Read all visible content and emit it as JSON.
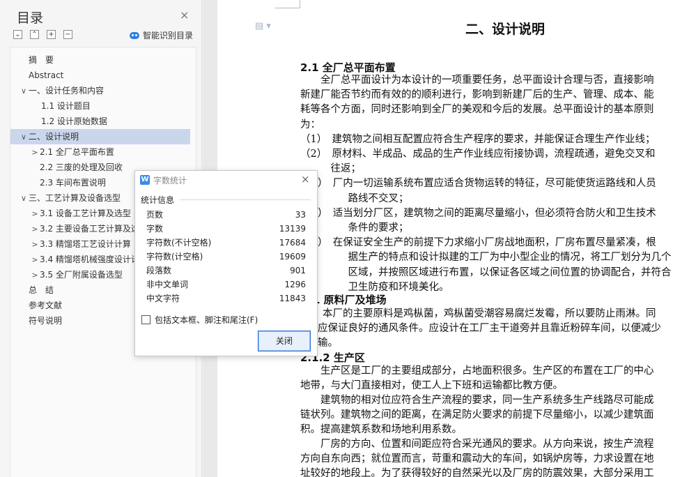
{
  "toc": {
    "title": "目录",
    "close": "×",
    "smart_label": "智能识别目录",
    "items": [
      {
        "label": "摘　要",
        "indent": 0,
        "arrow": ""
      },
      {
        "label": "Abstract",
        "indent": 0,
        "arrow": ""
      },
      {
        "label": "一、设计任务和内容",
        "indent": 0,
        "arrow": "∨"
      },
      {
        "label": "1.1  设计题目",
        "indent": 2,
        "arrow": ""
      },
      {
        "label": "1.2  设计原始数据",
        "indent": 2,
        "arrow": ""
      },
      {
        "label": "二、设计说明",
        "indent": 0,
        "arrow": "∨",
        "selected": true
      },
      {
        "label": "2.1  全厂总平面布置",
        "indent": 1,
        "arrow": ">"
      },
      {
        "label": "2.2  三废的处理及回收",
        "indent": 1,
        "arrow": ""
      },
      {
        "label": "2.3  车间布置说明",
        "indent": 1,
        "arrow": ""
      },
      {
        "label": "三、工艺计算及设备选型",
        "indent": 0,
        "arrow": "∨"
      },
      {
        "label": "3.1  设备工艺计算及选型",
        "indent": 1,
        "arrow": ">"
      },
      {
        "label": "3.2  主要设备工艺计算及选型",
        "indent": 1,
        "arrow": ">"
      },
      {
        "label": "3.3  精馏塔工艺设计计算",
        "indent": 1,
        "arrow": ">"
      },
      {
        "label": "3.4  精馏塔机械强度设计计算",
        "indent": 1,
        "arrow": ">"
      },
      {
        "label": "3.5  全厂附属设备选型",
        "indent": 1,
        "arrow": ">"
      },
      {
        "label": "总　结",
        "indent": 0,
        "arrow": ""
      },
      {
        "label": "参考文献",
        "indent": 0,
        "arrow": ""
      },
      {
        "label": "符号说明",
        "indent": 0,
        "arrow": ""
      }
    ]
  },
  "document": {
    "heading": "二、设计说明",
    "section_2_1": "2.1 全厂总平面布置",
    "lines": [
      "　　全厂总平面设计为本设计的一项重要任务，总平面设计合理与否，直接影响",
      "新建厂能否节约而有效的的顺利进行，影响到新建厂后的生产、管理、成本、能",
      "耗等各个方面，同时还影响到全厂的美观和今后的发展。总平面设计的基本原则",
      "为：",
      "（1）　建筑物之间相互配置应符合生产程序的要求，并能保证合理生产作业线；",
      "（2）　原材料、半成品、成品的生产作业线应衔接协调，流程疏通，避免交叉和",
      "　　　往返；",
      "）　厂内一切运输系统布置应适合货物运转的特征，尽可能使货运路线和人员",
      "　　　路线不交叉；",
      "）　适当划分厂区，建筑物之间的距离尽量缩小，但必须符合防火和卫生技术",
      "　　　条件的要求；",
      "）　在保证安全生产的前提下力求缩小厂房战地面积，厂房布置尽量紧凑，根",
      "　　　据生产的特点和设计拟建的工厂为中小型企业的情况，将工厂划分为几个",
      "　　　区域，并按照区域进行布置，以保证各区域之间位置的协调配合，并符合",
      "　　　卫生防疫和环境美化。"
    ],
    "sub_1": "1  原料厂及堆场",
    "lines2": [
      "本厂的主要原料是鸡枞菌，鸡枞菌受潮容易腐烂发霉，所以要防止雨淋。同",
      "应保证良好的通风条件。应设计在工厂主干道旁并且靠近粉碎车间，以便减少",
      "输。"
    ],
    "sub_2": "2.1.2  生产区",
    "lines3": [
      "　　生产区是工厂的主要组成部分，占地面积很多。生产区的布置在工厂的中心",
      "地带，与大门直接相对，使工人上下班和运输都比教方便。",
      "　　建筑物的相对位应符合生产流程的要求，同一生产系统多生产线路尽可能成",
      "链状列。建筑物之间的距离，在满足防火要求的前提下尽量缩小，以减少建筑面",
      "积。提高建筑系数和场地利用系数。",
      "　　厂房的方向、位置和间距应符合采光通风的要求。从方向来说，按生产流程",
      "方向自东向西；就位置而言，苛重和震动大的车间，如锅炉房等，力求设置在地",
      "址较好的地段上。为了获得较好的自然采光以及厂房的防震效果，大部分采用工"
    ]
  },
  "dialog": {
    "title": "字数统计",
    "close": "×",
    "section": "统计信息",
    "stats": [
      {
        "label": "页数",
        "value": "33"
      },
      {
        "label": "字数",
        "value": "13139"
      },
      {
        "label": "字符数(不计空格)",
        "value": "17684"
      },
      {
        "label": "字符数(计空格)",
        "value": "19609"
      },
      {
        "label": "段落数",
        "value": "901"
      },
      {
        "label": "非中文单词",
        "value": "1296"
      },
      {
        "label": "中文字符",
        "value": "11843"
      }
    ],
    "checkbox_label": "包括文本框、脚注和尾注(F)",
    "close_button": "关闭"
  }
}
